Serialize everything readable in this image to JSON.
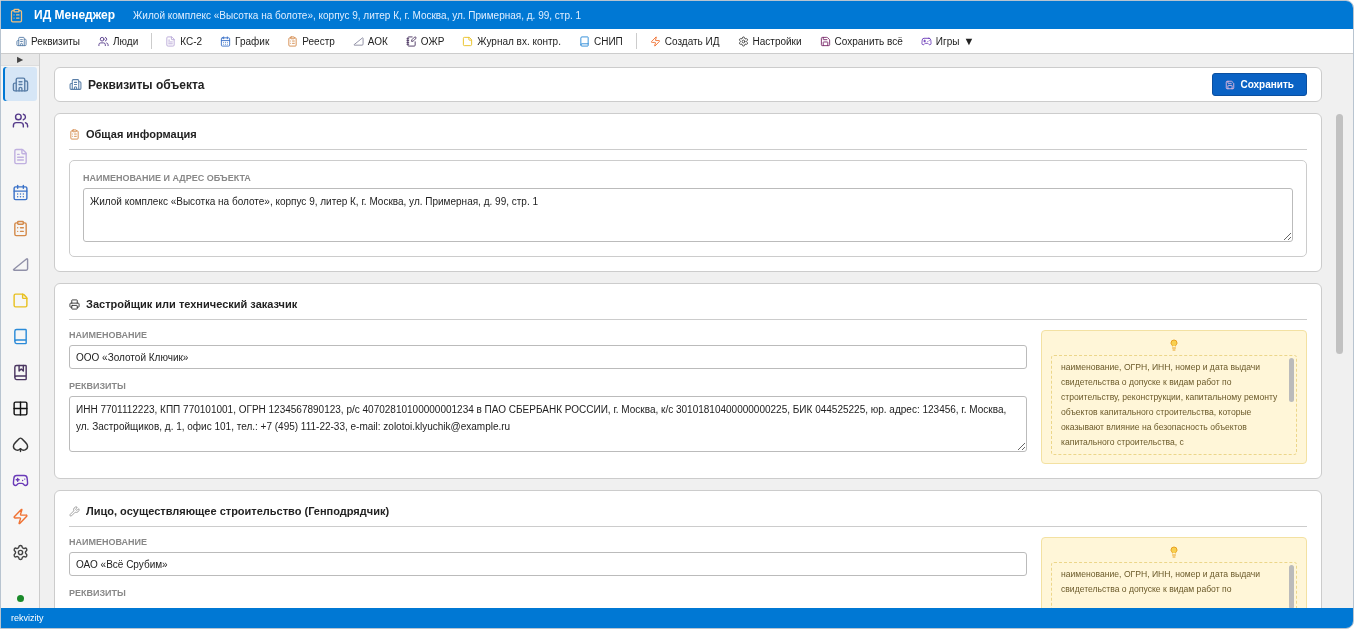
{
  "window": {
    "title": "ИД Менеджер",
    "subtitle": "Жилой комплекс «Высотка на болоте», корпус 9, литер К, г. Москва, ул. Примерная, д. 99, стр. 1"
  },
  "toolbar": {
    "groups": [
      [
        {
          "label": "Реквизиты"
        },
        {
          "label": "Люди"
        }
      ],
      [
        {
          "label": "КС-2"
        },
        {
          "label": "График"
        },
        {
          "label": "Реестр"
        },
        {
          "label": "АОК"
        },
        {
          "label": "ОЖР"
        },
        {
          "label": "Журнал вх. контр."
        },
        {
          "label": "СНИП"
        }
      ],
      [
        {
          "label": "Создать ИД"
        },
        {
          "label": "Настройки"
        },
        {
          "label": "Сохранить всё"
        },
        {
          "label": "Игры",
          "caret": "▼"
        }
      ]
    ]
  },
  "sidebar": {
    "toggle": "▶",
    "items": [
      {
        "selected": true
      },
      {
        "selected": false
      },
      {
        "selected": false
      },
      {
        "selected": false
      },
      {
        "selected": false
      },
      {
        "selected": false
      },
      {
        "selected": false
      },
      {
        "selected": false
      },
      {
        "selected": false
      },
      {
        "selected": false
      },
      {
        "selected": false
      },
      {
        "selected": false
      },
      {
        "selected": false
      },
      {
        "selected": false
      }
    ],
    "online": true
  },
  "page": {
    "title": "Реквизиты объекта",
    "save_button": "Сохранить"
  },
  "sections": [
    {
      "kind": "fieldset",
      "title": "Общая информация",
      "label": "НАИМЕНОВАНИЕ И АДРЕС ОБЪЕКТА",
      "value": "Жилой комплекс «Высотка на болоте», корпус 9, литер К, г. Москва, ул. Примерная, д. 99, стр. 1"
    },
    {
      "kind": "party",
      "title": "Застройщик или технический заказчик",
      "name_label": "НАИМЕНОВАНИЕ",
      "name": "ООО «Золотой Ключик»",
      "details_label": "РЕКВИЗИТЫ",
      "details": "ИНН 7701112223, КПП 770101001, ОГРН 1234567890123, р/с 40702810100000001234 в ПАО СБЕРБАНК РОССИИ, г. Москва, к/с 30101810400000000225, БИК 044525225, юр. адрес: 123456, г. Москва, ул. Застройщиков, д. 1, офис 101, тел.: +7 (495) 111-22-33, e-mail: zolotoi.klyuchik@example.ru",
      "hint": "наименование, ОГРН, ИНН, номер и дата выдачи свидетельства о допуске к видам работ по строительству, реконструкции, капитальному ремонту объектов капитального строительства, которые оказывают влияние на безопасность объектов капитального строительства, с"
    },
    {
      "kind": "party",
      "title": "Лицо, осуществляющее строительство (Генподрядчик)",
      "name_label": "НАИМЕНОВАНИЕ",
      "name": "ОАО «Всё Срубим»",
      "details_label": "РЕКВИЗИТЫ",
      "hint": "наименование, ОГРН, ИНН, номер и дата выдачи свидетельства о допуске к видам работ по"
    }
  ],
  "status_bar": {
    "text": "rekvizity"
  }
}
